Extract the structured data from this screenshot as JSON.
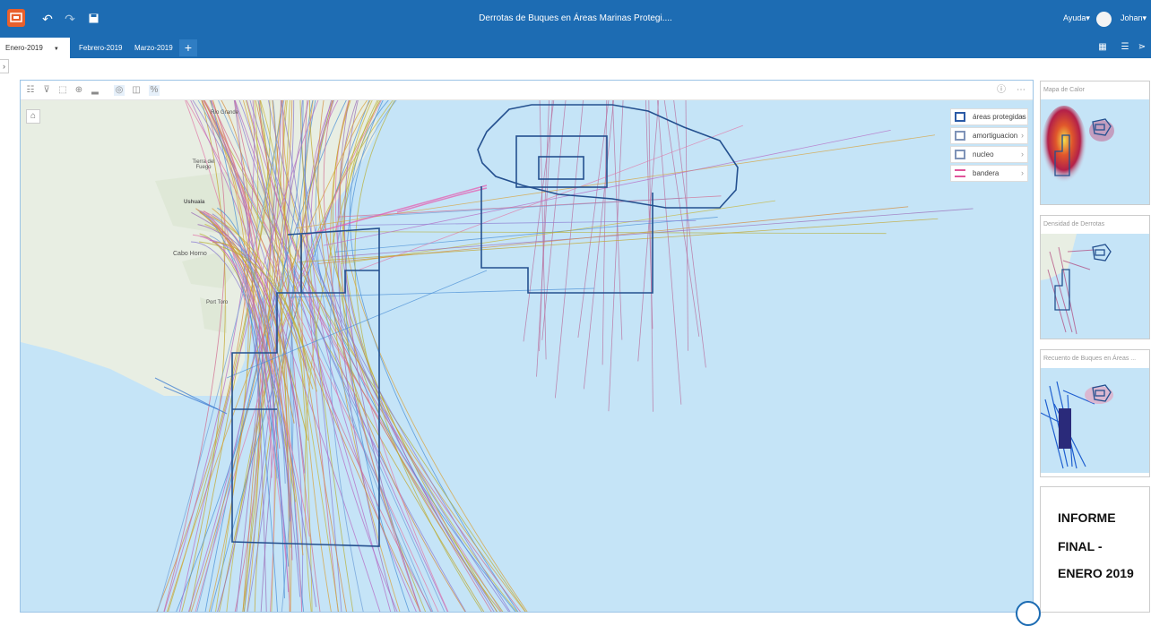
{
  "app": {
    "title": "Derrotas de Buques en Áreas Marinas Protegi....",
    "help_label": "Ayuda▾",
    "user_label": "Johan▾"
  },
  "tabs": [
    {
      "label": "Enero-2019"
    },
    {
      "label": "Febrero-2019"
    },
    {
      "label": "Marzo-2019"
    }
  ],
  "add_tab_label": "+",
  "map": {
    "place_labels": {
      "rio_grande": "Río Grande",
      "tierra_del_fuego": "Tierra del Fuego",
      "ushuaia": "Ushuaia",
      "cabo_hornos": "Cabo Horno",
      "port_toro": "Port Toro"
    },
    "legend": [
      {
        "label": "áreas protegidas",
        "swatch": "#2b5aa6"
      },
      {
        "label": "amortiguacion",
        "swatch": "#7f93b8"
      },
      {
        "label": "nucleo",
        "swatch": "#7f93b8"
      },
      {
        "label": "bandera",
        "swatch": "#e0559a"
      }
    ]
  },
  "cards": [
    {
      "title": "Mapa de Calor"
    },
    {
      "title": "Densidad de Derrotas"
    },
    {
      "title": "Recuento de Buques en Áreas ..."
    }
  ],
  "report": {
    "line1": "INFORME",
    "line2": "FINAL -",
    "line3": "ENERO 2019"
  },
  "colors": {
    "brand": "#1d6cb3",
    "ocean": "#c5e4f7",
    "land": "#e8eee3",
    "boundary": "#24508f"
  }
}
